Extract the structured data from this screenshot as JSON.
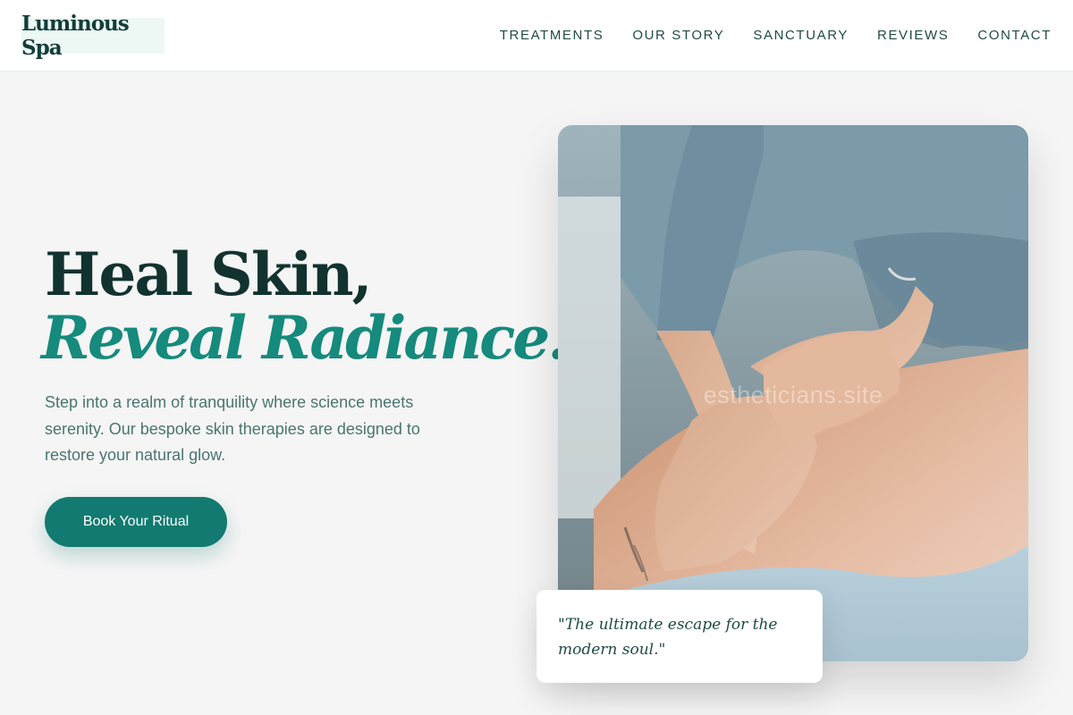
{
  "brand": {
    "logo_text": "Luminous Spa"
  },
  "nav": {
    "items": [
      {
        "label": "TREATMENTS"
      },
      {
        "label": "OUR STORY"
      },
      {
        "label": "SANCTUARY"
      },
      {
        "label": "REVIEWS"
      },
      {
        "label": "CONTACT"
      }
    ]
  },
  "hero": {
    "title_line1": "Heal Skin,",
    "title_line2": "Reveal Radiance.",
    "description": "Step into a realm of tranquility where science meets serenity. Our bespoke skin therapies are designed to restore your natural glow.",
    "cta_label": "Book Your Ritual"
  },
  "image": {
    "watermark": "estheticians.site",
    "subject": "therapist massaging a client's back"
  },
  "testimonial": {
    "quote": "\"The ultimate escape for the modern soul.\""
  },
  "colors": {
    "brand_dark": "#12322f",
    "accent_teal": "#158a7d",
    "button": "#127a70",
    "background": "#f5f5f5",
    "logo_bg": "#edf8f4"
  }
}
